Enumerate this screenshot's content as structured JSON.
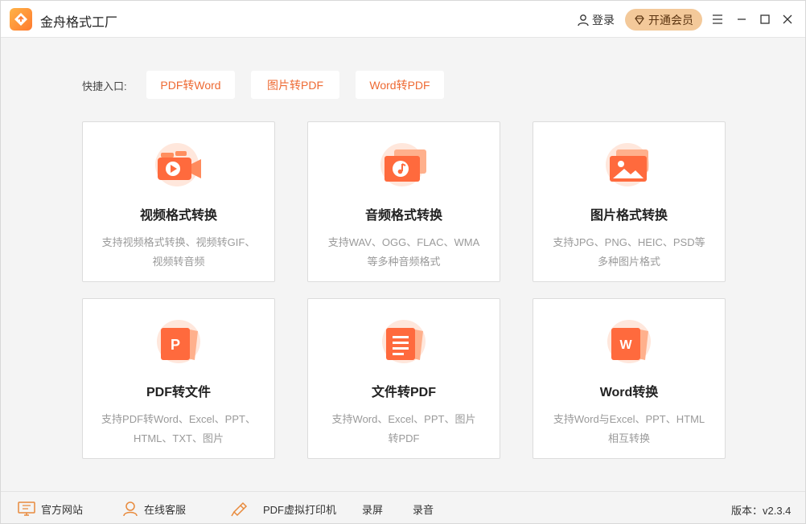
{
  "app": {
    "title": "金舟格式工厂",
    "login_label": "登录",
    "vip_label": "开通会员"
  },
  "colors": {
    "accent": "#ee6a33",
    "vip_bg": "#f3c99a",
    "icon_orange": "#ff7a3d"
  },
  "quick": {
    "label": "快捷入口:",
    "items": [
      "PDF转Word",
      "图片转PDF",
      "Word转PDF"
    ]
  },
  "cards": [
    {
      "icon": "video-icon",
      "title": "视频格式转换",
      "desc_line1": "支持视频格式转换、视频转GIF、",
      "desc_line2": "视频转音频"
    },
    {
      "icon": "audio-icon",
      "title": "音频格式转换",
      "desc_line1": "支持WAV、OGG、FLAC、WMA",
      "desc_line2": "等多种音频格式"
    },
    {
      "icon": "image-icon",
      "title": "图片格式转换",
      "desc_line1": "支持JPG、PNG、HEIC、PSD等",
      "desc_line2": "多种图片格式"
    },
    {
      "icon": "pdf-file-icon",
      "title": "PDF转文件",
      "desc_line1": "支持PDF转Word、Excel、PPT、",
      "desc_line2": "HTML、TXT、图片"
    },
    {
      "icon": "document-icon",
      "title": "文件转PDF",
      "desc_line1": "支持Word、Excel、PPT、图片",
      "desc_line2": "转PDF"
    },
    {
      "icon": "word-icon",
      "title": "Word转换",
      "desc_line1": "支持Word与Excel、PPT、HTML",
      "desc_line2": "相互转换"
    }
  ],
  "footer": {
    "website": "官方网站",
    "support": "在线客服",
    "pdf_printer": "PDF虚拟打印机",
    "screen_record": "录屏",
    "audio_record": "录音",
    "version": "版本：v2.3.4"
  }
}
